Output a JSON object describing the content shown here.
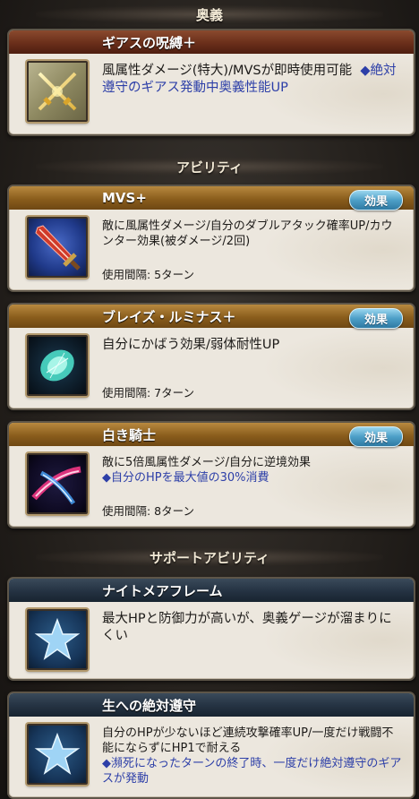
{
  "sections": {
    "ougi": "奥義",
    "ability": "アビリティ",
    "support": "サポートアビリティ"
  },
  "ougi_card": {
    "name": "ギアスの呪縛＋",
    "desc": "風属性ダメージ(特大)/MVSが即時使用可能",
    "desc_blue": "◆絶対遵守のギアス発動中奥義性能UP",
    "icon": "crossed-swords-icon"
  },
  "abilities": [
    {
      "name": "MVS+",
      "button": "効果",
      "desc": "敵に風属性ダメージ/自分のダブルアタック確率UP/カウンター効果(被ダメージ/2回)",
      "cooldown": "使用間隔: 5ターン",
      "icon": "sword-icon"
    },
    {
      "name": "ブレイズ・ルミナス＋",
      "button": "効果",
      "desc": "自分にかばう効果/弱体耐性UP",
      "cooldown": "使用間隔: 7ターン",
      "icon": "energy-shield-icon"
    },
    {
      "name": "白き騎士",
      "button": "効果",
      "desc": "敵に5倍風属性ダメージ/自分に逆境効果",
      "desc_blue": "◆自分のHPを最大値の30%消費",
      "cooldown": "使用間隔: 8ターン",
      "icon": "slash-icon"
    }
  ],
  "supports": [
    {
      "name": "ナイトメアフレーム",
      "desc": "最大HPと防御力が高いが、奥義ゲージが溜まりにくい",
      "icon": "star-icon"
    },
    {
      "name": "生への絶対遵守",
      "desc": "自分のHPが少ないほど連続攻撃確率UP/一度だけ戦闘不能にならずにHP1で耐える",
      "desc_blue": "◆瀕死になったターンの終了時、一度だけ絶対遵守のギアスが発動",
      "icon": "star-icon"
    }
  ]
}
